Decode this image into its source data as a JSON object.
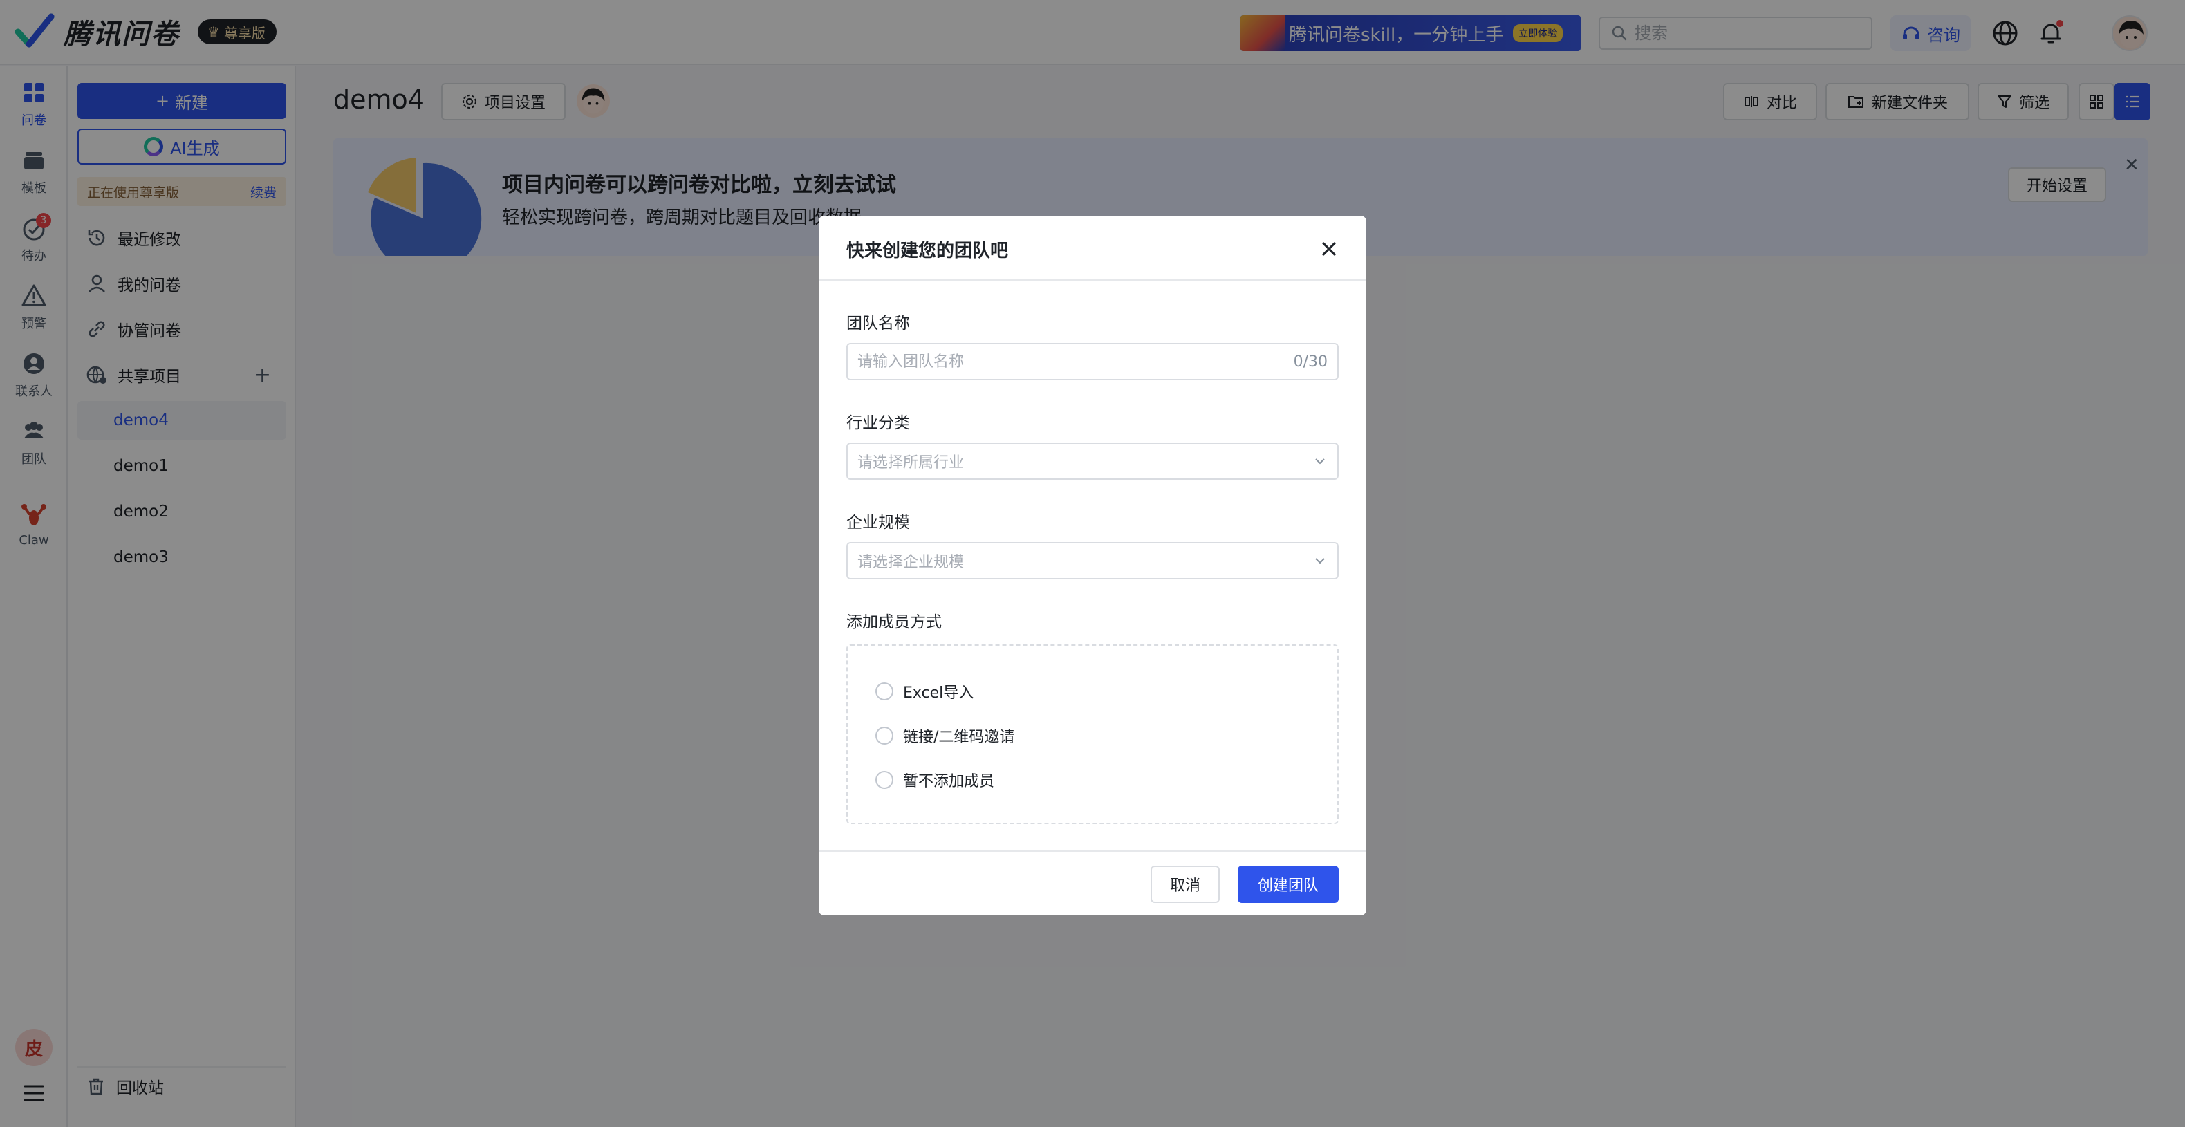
{
  "colors": {
    "accent": "#2f54eb",
    "overlay": "rgba(0,0,0,0.45)",
    "badge": "#f5454a"
  },
  "topbar": {
    "brand": "腾讯问卷",
    "edition_badge": "尊享版",
    "promo_text": "腾讯问卷skill，一分钟上手",
    "promo_button": "立即体验",
    "search_placeholder": "搜索",
    "consult_label": "咨询",
    "icons": [
      "globe-icon",
      "bell-icon"
    ]
  },
  "rail": {
    "items": [
      {
        "label": "问卷",
        "icon": "grid-icon",
        "active": true
      },
      {
        "label": "模板",
        "icon": "stack-icon"
      },
      {
        "label": "待办",
        "icon": "check-circle-icon",
        "badge": "3"
      },
      {
        "label": "预警",
        "icon": "warning-icon"
      },
      {
        "label": "联系人",
        "icon": "contact-icon"
      },
      {
        "label": "团队",
        "icon": "team-icon"
      },
      {
        "label": "Claw",
        "icon": "lobster-icon"
      }
    ],
    "user_initial": "皮"
  },
  "sidebar": {
    "new_button": "新建",
    "ai_button": "AI生成",
    "vip_status": "正在使用尊享版",
    "vip_renew": "续费",
    "items": [
      {
        "label": "最近修改",
        "icon": "history-icon"
      },
      {
        "label": "我的问卷",
        "icon": "user-icon"
      },
      {
        "label": "协管问卷",
        "icon": "link-icon"
      },
      {
        "label": "共享项目",
        "icon": "shared-globe-icon"
      }
    ],
    "projects": [
      "demo4",
      "demo1",
      "demo2",
      "demo3"
    ],
    "active_project": "demo4",
    "trash": "回收站"
  },
  "main": {
    "title": "demo4",
    "project_settings": "项目设置",
    "toolbar": {
      "compare": "对比",
      "new_folder": "新建文件夹",
      "filter": "筛选"
    },
    "banner": {
      "title": "项目内问卷可以跨问卷对比啦，立刻去试试",
      "subtitle": "轻松实现跨问卷，跨周期对比题目及回收数据",
      "button": "开始设置"
    }
  },
  "modal": {
    "title": "快来创建您的团队吧",
    "team_name_label": "团队名称",
    "team_name_placeholder": "请输入团队名称",
    "team_name_value": "",
    "team_name_count": "0/30",
    "industry_label": "行业分类",
    "industry_placeholder": "请选择所属行业",
    "scale_label": "企业规模",
    "scale_placeholder": "请选择企业规模",
    "member_label": "添加成员方式",
    "member_options": [
      "Excel导入",
      "链接/二维码邀请",
      "暂不添加成员"
    ],
    "cancel": "取消",
    "create": "创建团队"
  }
}
